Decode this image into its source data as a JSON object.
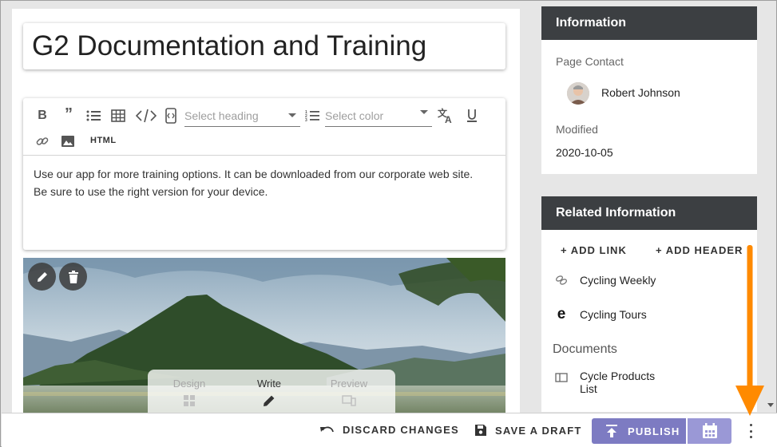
{
  "page": {
    "title": "G2 Documentation and Training"
  },
  "editor": {
    "toolbar": {
      "heading_placeholder": "Select heading",
      "color_placeholder": "Select color",
      "html_label": "HTML",
      "icons": [
        "bold-icon",
        "quote-icon",
        "bulleted-list-icon",
        "table-icon",
        "code-icon",
        "code-view-icon",
        "numbered-list-icon",
        "translate-icon",
        "underline-icon",
        "link-icon",
        "image-icon"
      ]
    },
    "body_line1": "Use our app for more training options. It can be downloaded from our corporate web site.",
    "body_line2": "Be sure to use the right version for your device."
  },
  "image_block": {
    "modes": [
      {
        "label": "Design",
        "icon": "design-grid-icon",
        "active": false
      },
      {
        "label": "Write",
        "icon": "pencil-icon",
        "active": true
      },
      {
        "label": "Preview",
        "icon": "devices-icon",
        "active": false
      }
    ],
    "buttons": [
      "edit-icon",
      "delete-icon"
    ]
  },
  "information": {
    "header": "Information",
    "contact_label": "Page Contact",
    "contact_name": "Robert Johnson",
    "modified_label": "Modified",
    "modified_value": "2020-10-05"
  },
  "related": {
    "header": "Related Information",
    "add_link": "+ ADD LINK",
    "add_header": "+ ADD HEADER",
    "links": [
      {
        "label": "Cycling Weekly",
        "icon": "link-icon"
      },
      {
        "label": "Cycling Tours",
        "icon": "edge-browser-icon"
      }
    ],
    "documents_label": "Documents",
    "documents": [
      {
        "label_line1": "Cycle Products",
        "label_line2": "List",
        "icon": "document-icon"
      }
    ]
  },
  "bottom_bar": {
    "discard": "DISCARD CHANGES",
    "save_draft": "SAVE A DRAFT",
    "publish": "PUBLISH"
  },
  "colors": {
    "header_bg": "#3c3f42",
    "publish": "#7d7bc2",
    "annotation_arrow": "#ff8a00"
  }
}
